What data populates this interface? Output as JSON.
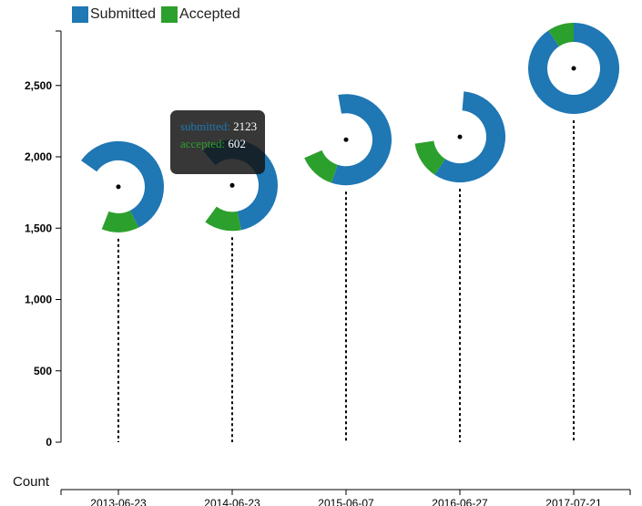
{
  "legend": {
    "items": [
      {
        "label": "Submitted",
        "color": "#1f77b4"
      },
      {
        "label": "Accepted",
        "color": "#2ca02c"
      }
    ]
  },
  "axis": {
    "x_label": "Count"
  },
  "tooltip": {
    "submitted_key": "submitted:",
    "submitted_value": "2123",
    "accepted_key": "accepted:",
    "accepted_value": "602"
  },
  "chart_data": {
    "type": "donut-lollipop",
    "categories": [
      "2013-06-23",
      "2014-06-23",
      "2015-06-07",
      "2016-06-27",
      "2017-07-21"
    ],
    "series": [
      {
        "name": "Submitted",
        "color": "#1f77b4"
      },
      {
        "name": "Accepted",
        "color": "#2ca02c"
      }
    ],
    "points": [
      {
        "date": "2013-06-23",
        "count": 1790,
        "submitted": 2123,
        "accepted": 602
      },
      {
        "date": "2014-06-23",
        "count": 1800,
        "submitted": 2123,
        "accepted": 602
      },
      {
        "date": "2015-06-07",
        "count": 2120,
        "submitted": 2123,
        "accepted": 602
      },
      {
        "date": "2016-06-27",
        "count": 2140,
        "submitted": 2123,
        "accepted": 602
      },
      {
        "date": "2017-07-21",
        "count": 2620,
        "submitted": 2123,
        "accepted": 602
      }
    ],
    "ylim": [
      0,
      2900
    ],
    "yticks": [
      0,
      500,
      1000,
      1500,
      2000,
      2500
    ],
    "ytick_labels": [
      "0",
      "500",
      "1,000",
      "1,500",
      "2,000",
      "2,500"
    ],
    "xlabel": "Count",
    "legend_position": "top-left"
  }
}
